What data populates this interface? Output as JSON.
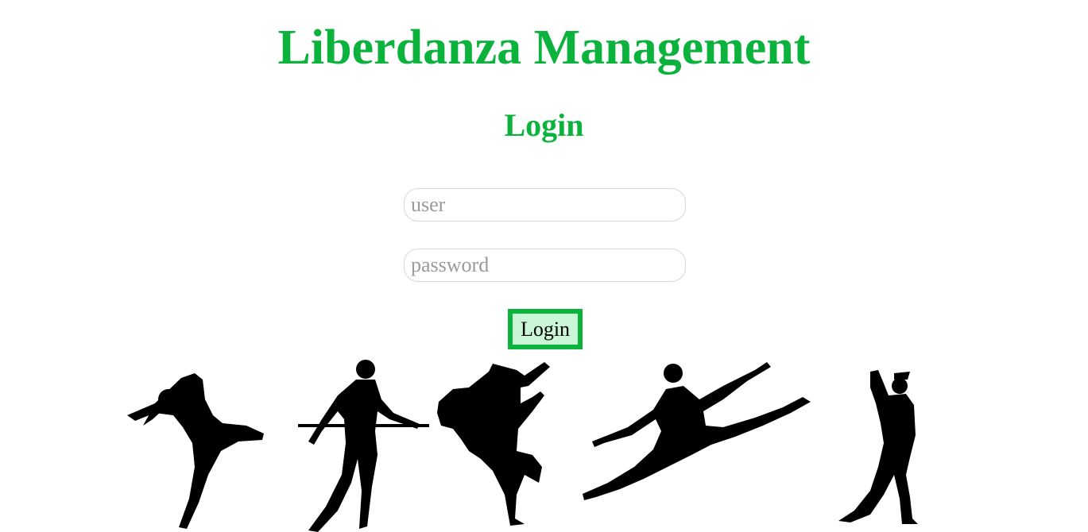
{
  "header": {
    "title": "Liberdanza Management",
    "subtitle": "Login"
  },
  "form": {
    "user_placeholder": "user",
    "password_placeholder": "password",
    "submit_label": "Login"
  },
  "banner": {
    "description_icon": "dancers-silhouettes-image"
  },
  "colors": {
    "accent": "#0bb33d",
    "button_bg": "#c9f7d5"
  }
}
